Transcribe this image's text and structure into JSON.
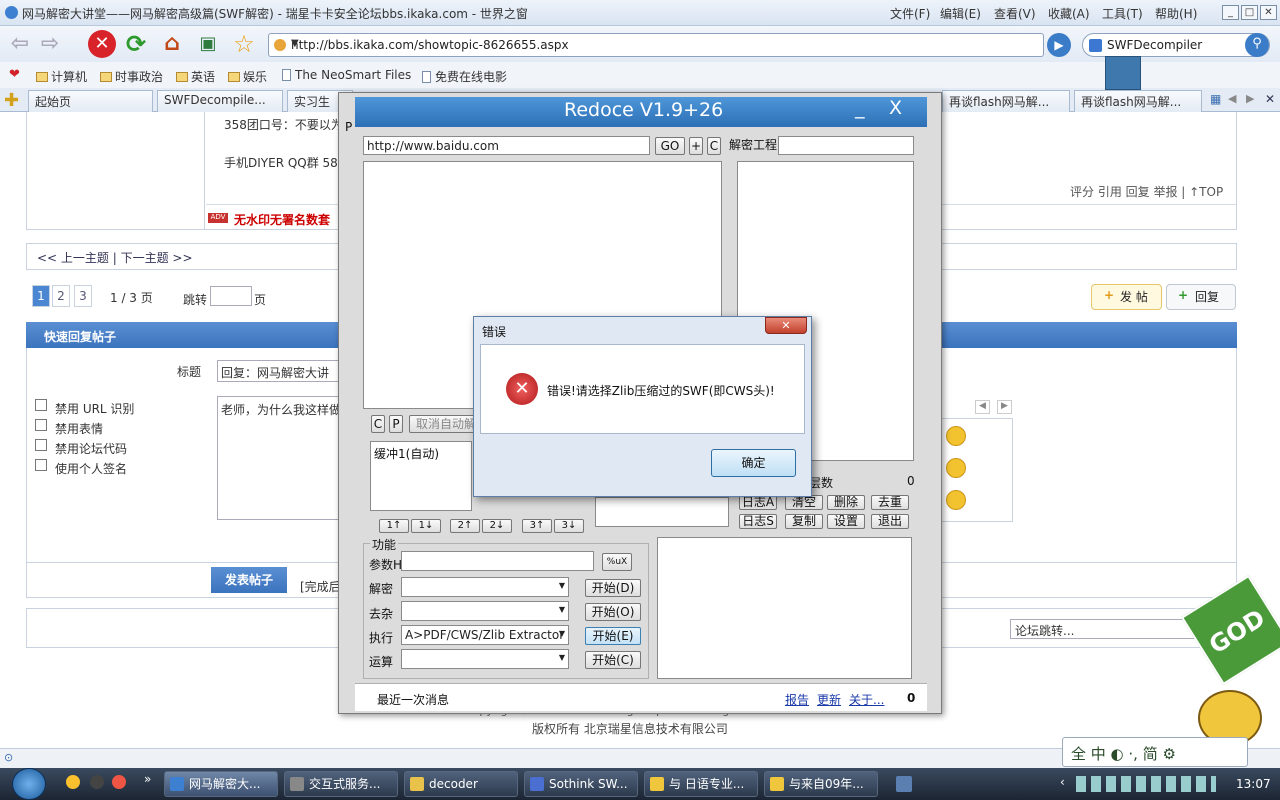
{
  "window": {
    "title": "网马解密大讲堂——网马解密高级篇(SWF解密) - 瑞星卡卡安全论坛bbs.ikaka.com - 世界之窗",
    "menus": [
      "文件(F)",
      "编辑(E)",
      "查看(V)",
      "收藏(A)",
      "工具(T)",
      "帮助(H)"
    ]
  },
  "nav": {
    "url": "http://bbs.ikaka.com/showtopic-8626655.aspx",
    "search": "SWFDecompiler"
  },
  "bookmarks": [
    "计算机",
    "时事政治",
    "英语",
    "娱乐",
    "The NeoSmart Files",
    "免费在线电影"
  ],
  "tabs": [
    "起始页",
    "SWFDecompile...",
    "实习生",
    "再谈flash网马解...",
    "再谈flash网马解..."
  ],
  "forum": {
    "group": "358团口号：不要以为",
    "qq": "手机DIYER  QQ群 58",
    "ad": "无水印无署名数套",
    "actions": "评分 引用 回复 举报 | ↑TOP",
    "prevnext": "<< 上一主题 | 下一主题 >>",
    "pages": [
      "1",
      "2",
      "3"
    ],
    "pageinfo": "1 / 3 页",
    "jump": "跳转",
    "page_suffix": "页",
    "post_btn": "发 帖",
    "reply_btn": "回复",
    "quick_reply": "快速回复帖子",
    "subject_label": "标题",
    "subject_value": "回复：网马解密大讲",
    "options": [
      "禁用 URL 识别",
      "禁用表情",
      "禁用论坛代码",
      "使用个人签名"
    ],
    "message": "老师，为什么我这样做",
    "submit": "发表帖子",
    "complete": "[完成后",
    "forum_jump": "论坛跳转...",
    "copyright": "Copyright©2000 - 2009 Rising Corp. Ltd.  All Rights Reserved",
    "rights": "版权所有 北京瑞星信息技术有限公司"
  },
  "redoce": {
    "title": "Redoce V1.9+26",
    "url": "http://www.baidu.com",
    "go": "GO",
    "plus": "+",
    "c": "C",
    "project_label": "解密工程",
    "c_btn": "C",
    "p_btn": "P",
    "cancel_auto": "取消自动解",
    "buffer": "缓冲1(自动)",
    "layers": "层数",
    "layers_count": "0",
    "arrows": [
      "1↑",
      "1↓",
      "2↑",
      "2↓",
      "3↑",
      "3↓"
    ],
    "log_buttons": [
      "日志A",
      "清空",
      "删除",
      "去重",
      "日志S",
      "复制",
      "设置",
      "退出"
    ],
    "func_label": "功能",
    "param_label": "参数H",
    "pct_btn": "%uX",
    "rows": [
      {
        "label": "解密",
        "value": "",
        "btn": "开始(D)"
      },
      {
        "label": "去杂",
        "value": "",
        "btn": "开始(O)"
      },
      {
        "label": "执行",
        "value": "A>PDF/CWS/Zlib Extractor",
        "btn": "开始(E)"
      },
      {
        "label": "运算",
        "value": "",
        "btn": "开始(C)"
      }
    ],
    "last_msg": "最近一次消息",
    "report": "报告",
    "update": "更新",
    "about": "关于...",
    "count": "0"
  },
  "dialog": {
    "title": "错误",
    "message": "错误!请选择Zlib压缩过的SWF(即CWS头)!",
    "ok": "确定"
  },
  "taskbar": {
    "items": [
      "网马解密大...",
      "交互式服务...",
      "decoder",
      "Sothink SW...",
      "与 日语专业...",
      "与来自09年..."
    ],
    "clock": "13:07"
  },
  "ime": "全 中 ◐ ·, 简 ⚙"
}
